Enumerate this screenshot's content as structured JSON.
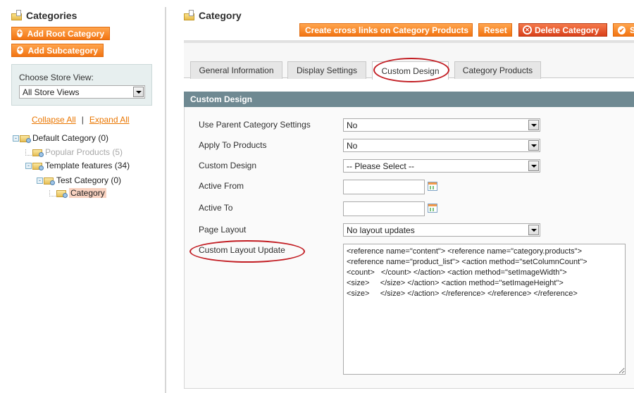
{
  "sidebar": {
    "title": "Categories",
    "add_root_label": "Add Root Category",
    "add_sub_label": "Add Subcategory",
    "store_view": {
      "label": "Choose Store View:",
      "selected": "All Store Views"
    },
    "collapse_all": "Collapse All",
    "separator": "|",
    "expand_all": "Expand All",
    "tree": [
      {
        "label": "Default Category (0)",
        "level": 0,
        "state": "expanded"
      },
      {
        "label": "Popular Products (5)",
        "level": 1,
        "state": "disabled"
      },
      {
        "label": "Template features (34)",
        "level": 1,
        "state": "expanded"
      },
      {
        "label": "Test Category (0)",
        "level": 2,
        "state": "expanded"
      },
      {
        "label": "Category",
        "level": 3,
        "state": "selected"
      }
    ]
  },
  "header": {
    "title": "Category",
    "buttons": {
      "cross_links": "Create cross links on Category Products",
      "reset": "Reset",
      "delete": "Delete Category",
      "save": "S"
    }
  },
  "tabs": [
    {
      "label": "General Information",
      "active": false
    },
    {
      "label": "Display Settings",
      "active": false
    },
    {
      "label": "Custom Design",
      "active": true
    },
    {
      "label": "Category Products",
      "active": false
    }
  ],
  "section": {
    "title": "Custom Design",
    "fields": {
      "use_parent": {
        "label": "Use Parent Category Settings",
        "value": "No"
      },
      "apply_products": {
        "label": "Apply To Products",
        "value": "No"
      },
      "custom_design": {
        "label": "Custom Design",
        "value": "-- Please Select --"
      },
      "active_from": {
        "label": "Active From",
        "value": ""
      },
      "active_to": {
        "label": "Active To",
        "value": ""
      },
      "page_layout": {
        "label": "Page Layout",
        "value": "No layout updates"
      },
      "custom_layout": {
        "label": "Custom Layout Update",
        "value": "<reference name=\"content\"> <reference name=\"category.products\">\n<reference name=\"product_list\"> <action method=\"setColumnCount\">\n<count>   </count> </action> <action method=\"setImageWidth\">\n<size>     </size> </action> <action method=\"setImageHeight\">\n<size>     </size> </action> </reference> </reference> </reference>"
      }
    }
  },
  "colors": {
    "accent_orange": "#f27412",
    "delete_red": "#d9401a",
    "section_header": "#6f8992",
    "link_orange": "#ea7601",
    "highlight_ellipse": "#c21d23",
    "selected_node_bg": "#f9d2c0"
  }
}
